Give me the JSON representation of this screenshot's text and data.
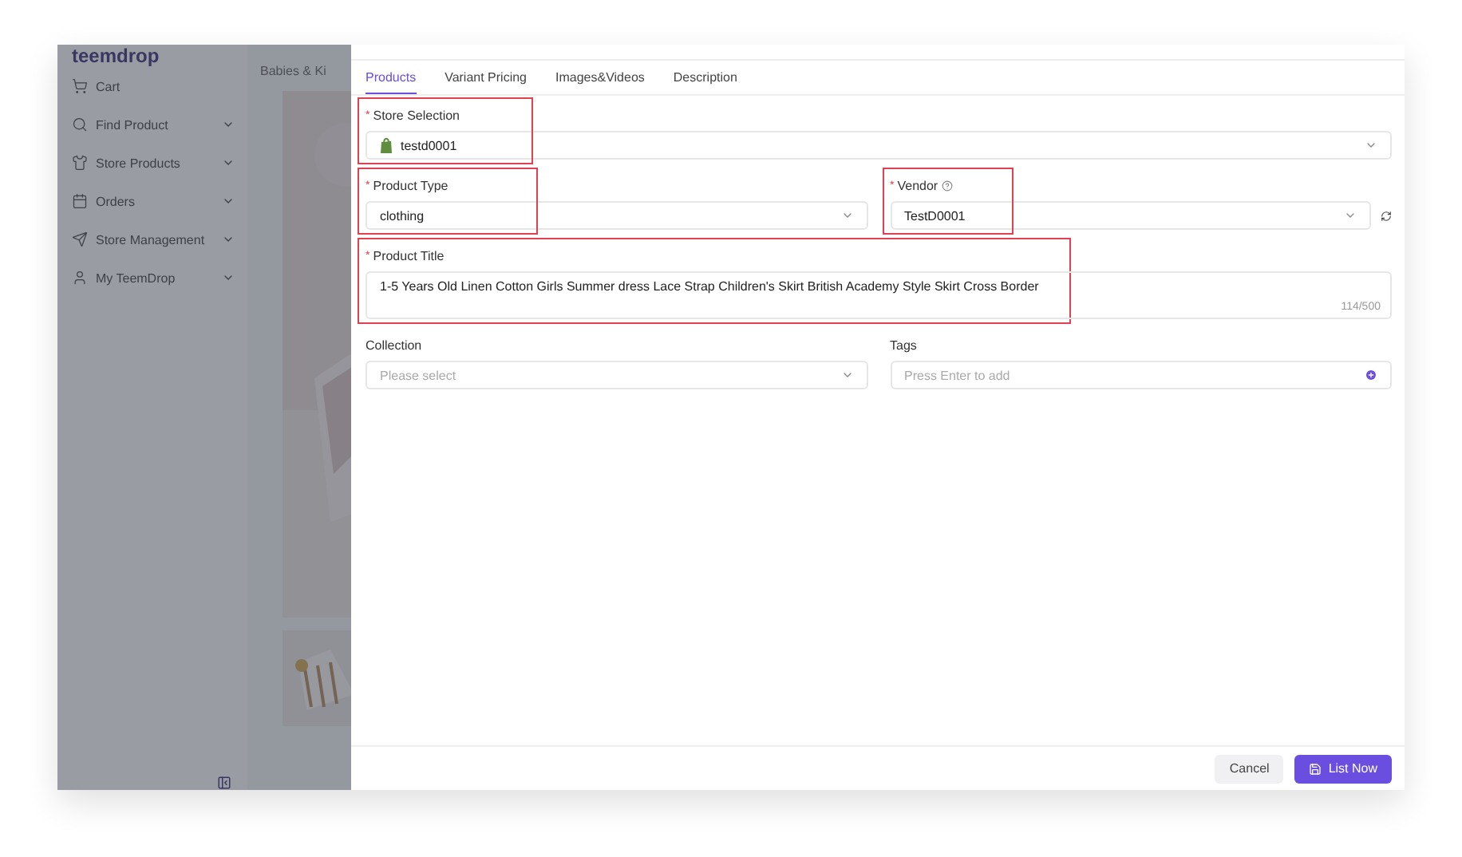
{
  "sidebar": {
    "logo": "teemdrop",
    "items": [
      {
        "label": "Cart",
        "expandable": false
      },
      {
        "label": "Find Product",
        "expandable": true
      },
      {
        "label": "Store Products",
        "expandable": true
      },
      {
        "label": "Orders",
        "expandable": true
      },
      {
        "label": "Store Management",
        "expandable": true
      },
      {
        "label": "My TeemDrop",
        "expandable": true
      }
    ]
  },
  "background_page": {
    "breadcrumb": "Babies & Ki"
  },
  "drawer": {
    "tabs": [
      {
        "label": "Products",
        "selected": true
      },
      {
        "label": "Variant Pricing",
        "selected": false
      },
      {
        "label": "Images&Videos",
        "selected": false
      },
      {
        "label": "Description",
        "selected": false
      }
    ],
    "store_selection": {
      "label": "Store Selection",
      "required_mark": "*",
      "highlighted": true,
      "value": "testd0001"
    },
    "product_type": {
      "label": "Product Type",
      "required_mark": "*",
      "highlighted": true,
      "value": "clothing"
    },
    "vendor": {
      "label": "Vendor",
      "required_mark": "*",
      "highlighted": true,
      "value": "TestD0001"
    },
    "product_title": {
      "label": "Product Title",
      "required_mark": "*",
      "highlighted": true,
      "value": "1-5 Years Old Linen Cotton Girls Summer dress Lace Strap Children's Skirt British Academy Style Skirt Cross Border",
      "counter": "114/500"
    },
    "collection": {
      "label": "Collection",
      "highlighted": false,
      "placeholder": "Please select"
    },
    "tags": {
      "label": "Tags",
      "highlighted": false,
      "placeholder": "Press Enter to add"
    },
    "buttons": [
      {
        "label": "Cancel",
        "kind": "secondary"
      },
      {
        "label": "List Now",
        "kind": "primary"
      }
    ]
  }
}
